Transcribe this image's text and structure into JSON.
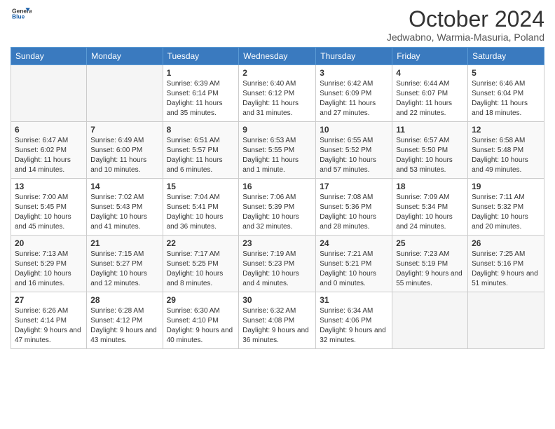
{
  "header": {
    "logo_line1": "General",
    "logo_line2": "Blue",
    "title": "October 2024",
    "subtitle": "Jedwabno, Warmia-Masuria, Poland"
  },
  "days_of_week": [
    "Sunday",
    "Monday",
    "Tuesday",
    "Wednesday",
    "Thursday",
    "Friday",
    "Saturday"
  ],
  "weeks": [
    [
      {
        "day": "",
        "sunrise": "",
        "sunset": "",
        "daylight": ""
      },
      {
        "day": "",
        "sunrise": "",
        "sunset": "",
        "daylight": ""
      },
      {
        "day": "1",
        "sunrise": "Sunrise: 6:39 AM",
        "sunset": "Sunset: 6:14 PM",
        "daylight": "Daylight: 11 hours and 35 minutes."
      },
      {
        "day": "2",
        "sunrise": "Sunrise: 6:40 AM",
        "sunset": "Sunset: 6:12 PM",
        "daylight": "Daylight: 11 hours and 31 minutes."
      },
      {
        "day": "3",
        "sunrise": "Sunrise: 6:42 AM",
        "sunset": "Sunset: 6:09 PM",
        "daylight": "Daylight: 11 hours and 27 minutes."
      },
      {
        "day": "4",
        "sunrise": "Sunrise: 6:44 AM",
        "sunset": "Sunset: 6:07 PM",
        "daylight": "Daylight: 11 hours and 22 minutes."
      },
      {
        "day": "5",
        "sunrise": "Sunrise: 6:46 AM",
        "sunset": "Sunset: 6:04 PM",
        "daylight": "Daylight: 11 hours and 18 minutes."
      }
    ],
    [
      {
        "day": "6",
        "sunrise": "Sunrise: 6:47 AM",
        "sunset": "Sunset: 6:02 PM",
        "daylight": "Daylight: 11 hours and 14 minutes."
      },
      {
        "day": "7",
        "sunrise": "Sunrise: 6:49 AM",
        "sunset": "Sunset: 6:00 PM",
        "daylight": "Daylight: 11 hours and 10 minutes."
      },
      {
        "day": "8",
        "sunrise": "Sunrise: 6:51 AM",
        "sunset": "Sunset: 5:57 PM",
        "daylight": "Daylight: 11 hours and 6 minutes."
      },
      {
        "day": "9",
        "sunrise": "Sunrise: 6:53 AM",
        "sunset": "Sunset: 5:55 PM",
        "daylight": "Daylight: 11 hours and 1 minute."
      },
      {
        "day": "10",
        "sunrise": "Sunrise: 6:55 AM",
        "sunset": "Sunset: 5:52 PM",
        "daylight": "Daylight: 10 hours and 57 minutes."
      },
      {
        "day": "11",
        "sunrise": "Sunrise: 6:57 AM",
        "sunset": "Sunset: 5:50 PM",
        "daylight": "Daylight: 10 hours and 53 minutes."
      },
      {
        "day": "12",
        "sunrise": "Sunrise: 6:58 AM",
        "sunset": "Sunset: 5:48 PM",
        "daylight": "Daylight: 10 hours and 49 minutes."
      }
    ],
    [
      {
        "day": "13",
        "sunrise": "Sunrise: 7:00 AM",
        "sunset": "Sunset: 5:45 PM",
        "daylight": "Daylight: 10 hours and 45 minutes."
      },
      {
        "day": "14",
        "sunrise": "Sunrise: 7:02 AM",
        "sunset": "Sunset: 5:43 PM",
        "daylight": "Daylight: 10 hours and 41 minutes."
      },
      {
        "day": "15",
        "sunrise": "Sunrise: 7:04 AM",
        "sunset": "Sunset: 5:41 PM",
        "daylight": "Daylight: 10 hours and 36 minutes."
      },
      {
        "day": "16",
        "sunrise": "Sunrise: 7:06 AM",
        "sunset": "Sunset: 5:39 PM",
        "daylight": "Daylight: 10 hours and 32 minutes."
      },
      {
        "day": "17",
        "sunrise": "Sunrise: 7:08 AM",
        "sunset": "Sunset: 5:36 PM",
        "daylight": "Daylight: 10 hours and 28 minutes."
      },
      {
        "day": "18",
        "sunrise": "Sunrise: 7:09 AM",
        "sunset": "Sunset: 5:34 PM",
        "daylight": "Daylight: 10 hours and 24 minutes."
      },
      {
        "day": "19",
        "sunrise": "Sunrise: 7:11 AM",
        "sunset": "Sunset: 5:32 PM",
        "daylight": "Daylight: 10 hours and 20 minutes."
      }
    ],
    [
      {
        "day": "20",
        "sunrise": "Sunrise: 7:13 AM",
        "sunset": "Sunset: 5:29 PM",
        "daylight": "Daylight: 10 hours and 16 minutes."
      },
      {
        "day": "21",
        "sunrise": "Sunrise: 7:15 AM",
        "sunset": "Sunset: 5:27 PM",
        "daylight": "Daylight: 10 hours and 12 minutes."
      },
      {
        "day": "22",
        "sunrise": "Sunrise: 7:17 AM",
        "sunset": "Sunset: 5:25 PM",
        "daylight": "Daylight: 10 hours and 8 minutes."
      },
      {
        "day": "23",
        "sunrise": "Sunrise: 7:19 AM",
        "sunset": "Sunset: 5:23 PM",
        "daylight": "Daylight: 10 hours and 4 minutes."
      },
      {
        "day": "24",
        "sunrise": "Sunrise: 7:21 AM",
        "sunset": "Sunset: 5:21 PM",
        "daylight": "Daylight: 10 hours and 0 minutes."
      },
      {
        "day": "25",
        "sunrise": "Sunrise: 7:23 AM",
        "sunset": "Sunset: 5:19 PM",
        "daylight": "Daylight: 9 hours and 55 minutes."
      },
      {
        "day": "26",
        "sunrise": "Sunrise: 7:25 AM",
        "sunset": "Sunset: 5:16 PM",
        "daylight": "Daylight: 9 hours and 51 minutes."
      }
    ],
    [
      {
        "day": "27",
        "sunrise": "Sunrise: 6:26 AM",
        "sunset": "Sunset: 4:14 PM",
        "daylight": "Daylight: 9 hours and 47 minutes."
      },
      {
        "day": "28",
        "sunrise": "Sunrise: 6:28 AM",
        "sunset": "Sunset: 4:12 PM",
        "daylight": "Daylight: 9 hours and 43 minutes."
      },
      {
        "day": "29",
        "sunrise": "Sunrise: 6:30 AM",
        "sunset": "Sunset: 4:10 PM",
        "daylight": "Daylight: 9 hours and 40 minutes."
      },
      {
        "day": "30",
        "sunrise": "Sunrise: 6:32 AM",
        "sunset": "Sunset: 4:08 PM",
        "daylight": "Daylight: 9 hours and 36 minutes."
      },
      {
        "day": "31",
        "sunrise": "Sunrise: 6:34 AM",
        "sunset": "Sunset: 4:06 PM",
        "daylight": "Daylight: 9 hours and 32 minutes."
      },
      {
        "day": "",
        "sunrise": "",
        "sunset": "",
        "daylight": ""
      },
      {
        "day": "",
        "sunrise": "",
        "sunset": "",
        "daylight": ""
      }
    ]
  ]
}
